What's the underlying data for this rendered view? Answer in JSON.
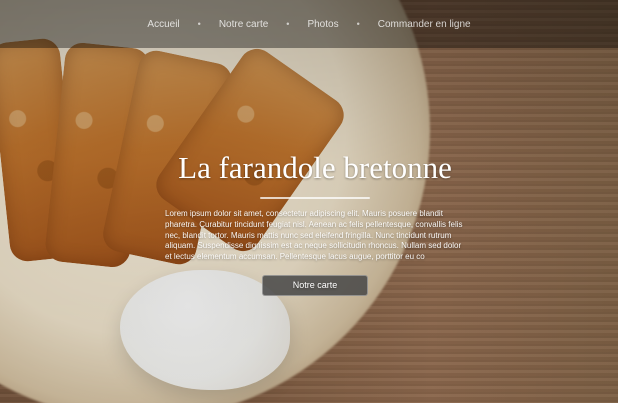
{
  "nav": {
    "items": [
      {
        "label": "Accueil"
      },
      {
        "label": "Notre carte"
      },
      {
        "label": "Photos"
      },
      {
        "label": "Commander en ligne"
      }
    ],
    "separator": "•"
  },
  "hero": {
    "title": "La farandole bretonne",
    "description": "Lorem ipsum dolor sit amet, consectetur adipiscing elit. Mauris posuere blandit pharetra. Curabitur tincidunt feugiat nisl. Aenean ac felis pellentesque, convallis felis nec, blandit tortor. Mauris mattis nunc sed eleifend fringilla. Nunc tincidunt rutrum aliquam. Suspendisse dignissim est ac neque sollicitudin rhoncus. Nullam sed dolor et lectus elementum accumsan. Pellentesque lacus augue, porttitor eu co",
    "cta_label": "Notre carte"
  },
  "colors": {
    "nav_overlay": "#000000",
    "button_bg": "#464646",
    "text": "#ffffff"
  }
}
